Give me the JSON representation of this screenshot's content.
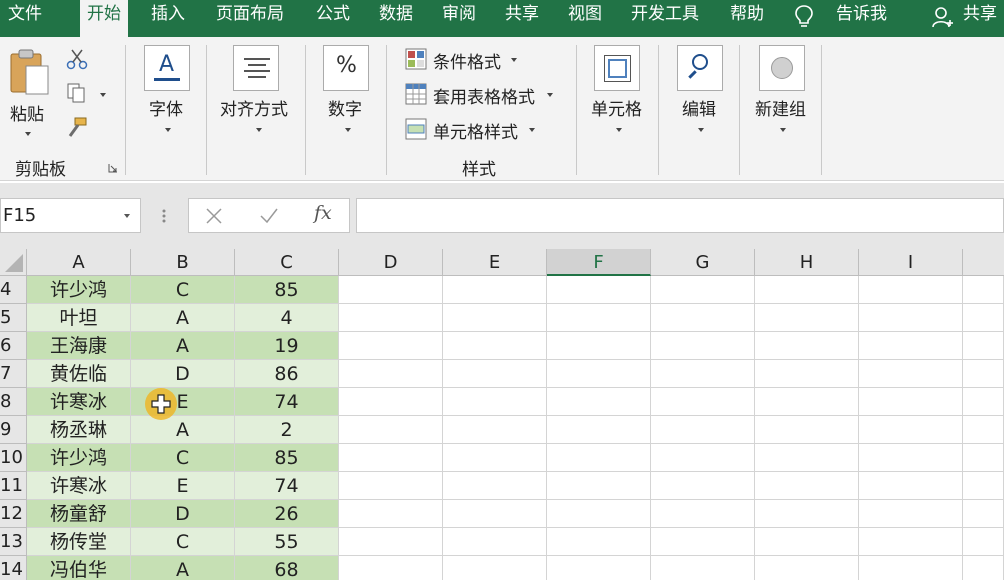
{
  "tabs": [
    {
      "label": "文件",
      "active": false
    },
    {
      "label": "开始",
      "active": true
    },
    {
      "label": "插入",
      "active": false
    },
    {
      "label": "页面布局",
      "active": false
    },
    {
      "label": "公式",
      "active": false
    },
    {
      "label": "数据",
      "active": false
    },
    {
      "label": "审阅",
      "active": false
    },
    {
      "label": "共享",
      "active": false
    },
    {
      "label": "视图",
      "active": false
    },
    {
      "label": "开发工具",
      "active": false
    },
    {
      "label": "帮助",
      "active": false
    }
  ],
  "tell_me": "告诉我",
  "share": "共享",
  "ribbon": {
    "paste": "粘贴",
    "clipboard_group": "剪贴板",
    "font": "字体",
    "alignment": "对齐方式",
    "number": "数字",
    "conditional_format": "条件格式",
    "format_as_table": "套用表格格式",
    "cell_styles": "单元格样式",
    "styles_group": "样式",
    "cells": "单元格",
    "editing": "编辑",
    "new_group": "新建组"
  },
  "name_box": "F15",
  "fx": "fx",
  "columns": [
    "A",
    "B",
    "C",
    "D",
    "E",
    "F",
    "G",
    "H",
    "I"
  ],
  "selected_column": "F",
  "rows": [
    {
      "num": "4",
      "name": "许少鸿",
      "grade": "C",
      "score": "85"
    },
    {
      "num": "5",
      "name": "叶坦",
      "grade": "A",
      "score": "4"
    },
    {
      "num": "6",
      "name": "王海康",
      "grade": "A",
      "score": "19"
    },
    {
      "num": "7",
      "name": "黄佐临",
      "grade": "D",
      "score": "86"
    },
    {
      "num": "8",
      "name": "许寒冰",
      "grade": "E",
      "score": "74"
    },
    {
      "num": "9",
      "name": "杨丞琳",
      "grade": "A",
      "score": "2"
    },
    {
      "num": "10",
      "name": "许少鸿",
      "grade": "C",
      "score": "85"
    },
    {
      "num": "11",
      "name": "许寒冰",
      "grade": "E",
      "score": "74"
    },
    {
      "num": "12",
      "name": "杨童舒",
      "grade": "D",
      "score": "26"
    },
    {
      "num": "13",
      "name": "杨传堂",
      "grade": "C",
      "score": "55"
    },
    {
      "num": "14",
      "name": "冯伯华",
      "grade": "A",
      "score": "68"
    }
  ],
  "colors": {
    "excel_green": "#217346",
    "band_dark": "#c6e0b4",
    "band_light": "#e2efda"
  }
}
